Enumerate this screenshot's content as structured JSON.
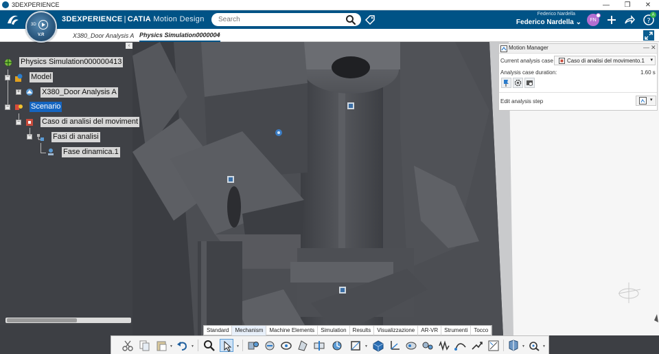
{
  "window": {
    "title": "3DEXPERIENCE",
    "controls": {
      "minimize": "—",
      "maximize": "❐",
      "close": "✕"
    }
  },
  "header": {
    "brand_3dx": "3DEXPERIENCE",
    "brand_sep": "|",
    "brand_catia": "CATIA",
    "brand_app": "Motion Design",
    "search_placeholder": "Search",
    "user_small": "Federico Nardella",
    "user_name": "Federico Nardella",
    "user_chevron": "⌄",
    "avatar_initials": "FN",
    "share_badge": "A"
  },
  "compass": {
    "label_3d": "3D",
    "version": "V.R"
  },
  "tabs": [
    {
      "label": "X380_Door Analysis A"
    },
    {
      "label": "Physics Simulation0000004"
    }
  ],
  "tab_add": "+",
  "tree": {
    "collapse": "‹",
    "root": "Physics Simulation000000413",
    "model": "Model",
    "x380": "X380_Door Analysis A",
    "scenario": "Scenario",
    "caso": "Caso di analisi del moviment",
    "fasi": "Fasi di analisi",
    "fase": "Fase dinamica.1",
    "toggle_plus": "+",
    "toggle_minus": "−"
  },
  "motion_manager": {
    "title": "Motion Manager",
    "minimize": "—",
    "close": "✕",
    "current_case_label": "Current analysis case",
    "current_case_value": "Caso di analisi del movimento.1",
    "dropdown_arrow": "▾",
    "duration_label": "Analysis case duration:",
    "duration_value": "1.60 s",
    "edit_step_label": "Edit analysis step"
  },
  "section_tabs": [
    {
      "label": "Standard"
    },
    {
      "label": "Mechanism"
    },
    {
      "label": "Machine Elements"
    },
    {
      "label": "Simulation"
    },
    {
      "label": "Results"
    },
    {
      "label": "Visualizzazione"
    },
    {
      "label": "AR-VR"
    },
    {
      "label": "Strumenti"
    },
    {
      "label": "Tocco"
    }
  ],
  "colors": {
    "header": "#005386",
    "tree_bg": "#3f4146",
    "selection": "#1565c0",
    "avatar": "#b36fd1"
  }
}
